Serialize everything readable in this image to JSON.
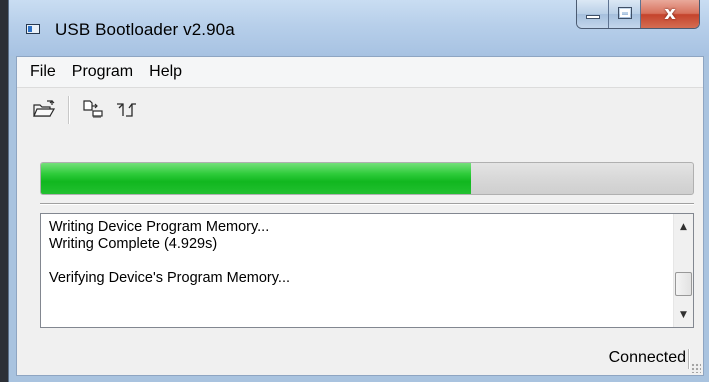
{
  "window": {
    "title": "USB Bootloader v2.90a",
    "icon": "app-window-icon",
    "caption_buttons": [
      "minimize-icon",
      "maximize-icon",
      "close-icon"
    ],
    "close_glyph": "x"
  },
  "menu": {
    "items": [
      "File",
      "Program",
      "Help"
    ]
  },
  "toolbar": {
    "buttons": [
      {
        "icon": "open-folder-icon"
      },
      {
        "icon": "write-device-icon"
      },
      {
        "icon": "reset-device-icon"
      }
    ]
  },
  "progress": {
    "percent": 66,
    "fill_color": "#22c030"
  },
  "log": {
    "lines": [
      "Writing Device Program Memory...",
      "Writing Complete (4.929s)",
      "Verifying Device's Program Memory..."
    ]
  },
  "status": {
    "text": "Connected"
  },
  "colors": {
    "accent_progress": "#22c030",
    "titlebar": "#b7cfea",
    "close_button": "#c4432c"
  }
}
